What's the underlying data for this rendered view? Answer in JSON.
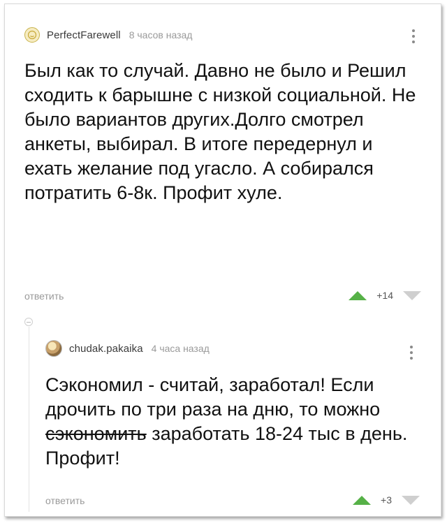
{
  "comments": [
    {
      "username": "PerfectFarewell",
      "time": "8 часов назад",
      "text": "Был как то случай. Давно не было и Решил сходить к барышне с низкой социальной. Не было вариантов других.Долго смотрел анкеты, выбирал. В итоге передернул и ехать желание под угасло. А собирался потратить 6-8к. Профит хуле.",
      "reply_label": "ответить",
      "score": "+14"
    },
    {
      "username": "chudak.pakaika",
      "time": "4 часа назад",
      "text_before": "Сэкономил - считай, заработал! Если дрочить по три раза на дню, то можно ",
      "text_strike": "сэкономить",
      "text_after": " заработать 18-24 тыс в день. Профит!",
      "reply_label": "ответить",
      "score": "+3"
    }
  ],
  "icons": {
    "avatar1": "user-avatar",
    "avatar2": "user-avatar",
    "menu": "more-vertical-icon",
    "upvote": "arrow-up-icon",
    "downvote": "arrow-down-icon",
    "collapse": "collapse-thread-icon"
  },
  "colors": {
    "upvote": "#56b147",
    "downvote": "#cfcfcf",
    "muted_text": "#9a9a9a"
  }
}
